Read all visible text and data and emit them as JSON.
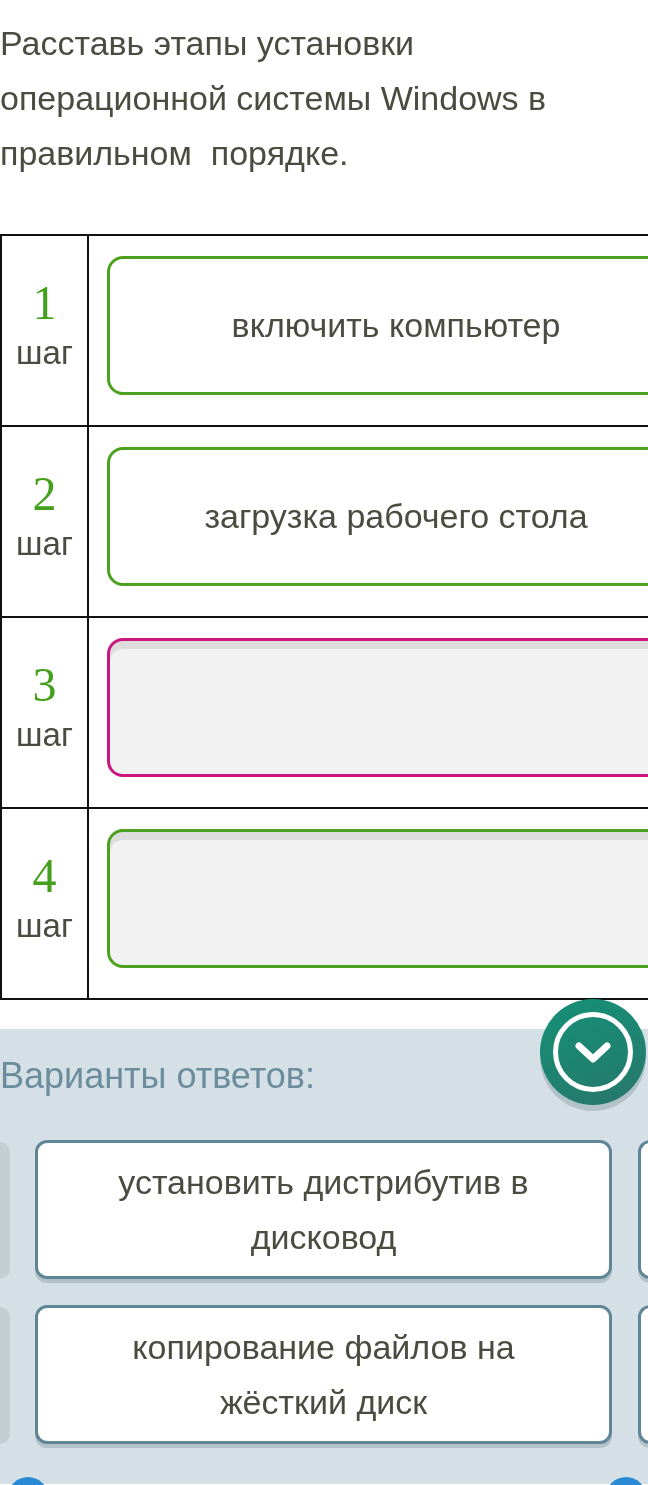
{
  "instruction": "Расставь этапы установки операционной системы Windows в правильном  порядке.",
  "steps": [
    {
      "number": "1",
      "unit": "шаг",
      "slot": {
        "text": "включить компьютер",
        "selected": false
      }
    },
    {
      "number": "2",
      "unit": "шаг",
      "slot": {
        "text": "загрузка рабочего стола",
        "selected": false
      }
    },
    {
      "number": "3",
      "unit": "шаг",
      "slot": {
        "selected": true
      }
    },
    {
      "number": "4",
      "unit": "шаг",
      "slot": {
        "selected": false
      }
    }
  ],
  "answers": {
    "title": "Варианты ответов:",
    "options": [
      {
        "text": "установить дистрибутив в дисковод"
      },
      {
        "text": "копирование файлов на жёсткий диск"
      }
    ]
  }
}
